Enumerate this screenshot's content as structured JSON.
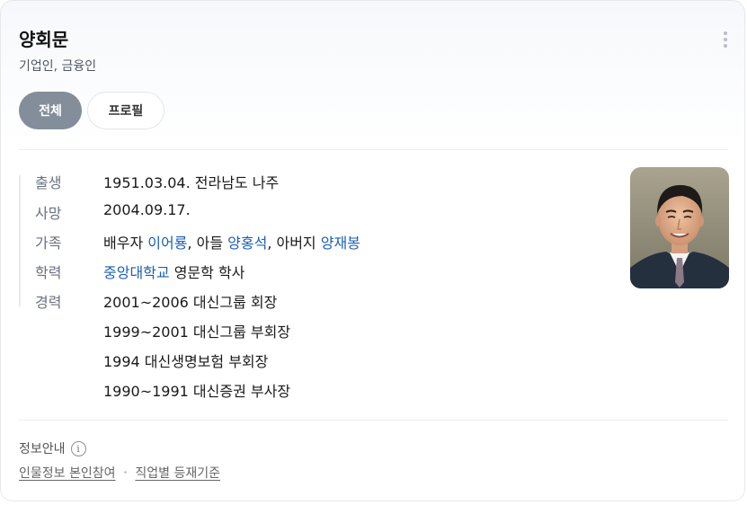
{
  "profile": {
    "name": "양회문",
    "occupation": "기업인, 금융인"
  },
  "tabs": [
    {
      "label": "전체",
      "active": true
    },
    {
      "label": "프로필",
      "active": false
    }
  ],
  "info": {
    "birth": {
      "label": "출생",
      "value": "1951.03.04. 전라남도 나주"
    },
    "death": {
      "label": "사망",
      "value": "2004.09.17."
    },
    "family": {
      "label": "가족",
      "spouse_prefix": "배우자 ",
      "spouse": "이어룡",
      "son_prefix": ", 아들 ",
      "son": "양홍석",
      "father_prefix": ", 아버지 ",
      "father": "양재봉"
    },
    "education": {
      "label": "학력",
      "school": "중앙대학교",
      "detail": " 영문학 학사"
    },
    "career": {
      "label": "경력",
      "items": [
        "2001~2006 대신그룹 회장",
        "1999~2001 대신그룹 부회장",
        "1994 대신생명보험 부회장",
        "1990~1991 대신증권 부사장"
      ]
    }
  },
  "footer": {
    "heading": "정보안내",
    "info_icon": "i",
    "link1": "인물정보 본인참여",
    "separator": "•",
    "link2": "직업별 등재기준"
  },
  "colors": {
    "link": "#1b5fb5",
    "active_tab": "#848e9b"
  }
}
